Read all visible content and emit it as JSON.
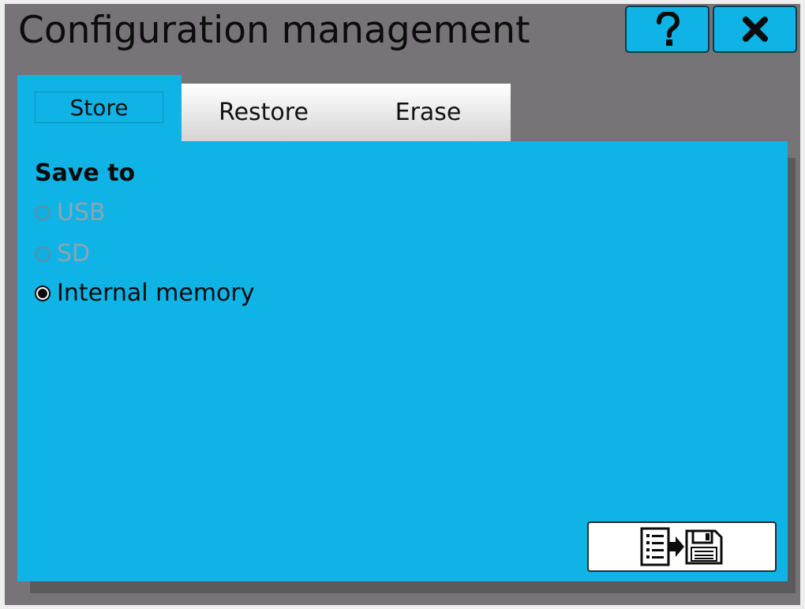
{
  "window": {
    "title": "Configuration management",
    "help_icon": "question-mark-icon",
    "close_icon": "close-x-icon"
  },
  "tabs": [
    {
      "label": "Store",
      "active": true
    },
    {
      "label": "Restore",
      "active": false
    },
    {
      "label": "Erase",
      "active": false
    }
  ],
  "store": {
    "section_title": "Save to",
    "options": [
      {
        "label": "USB",
        "selected": false,
        "enabled": false
      },
      {
        "label": "SD",
        "selected": false,
        "enabled": false
      },
      {
        "label": "Internal memory",
        "selected": true,
        "enabled": true
      }
    ],
    "action_icon": "save-config-to-disk-icon"
  },
  "colors": {
    "accent": "#10b3e6",
    "window_background": "#767476",
    "tab_inactive": "#e6e6e6"
  }
}
